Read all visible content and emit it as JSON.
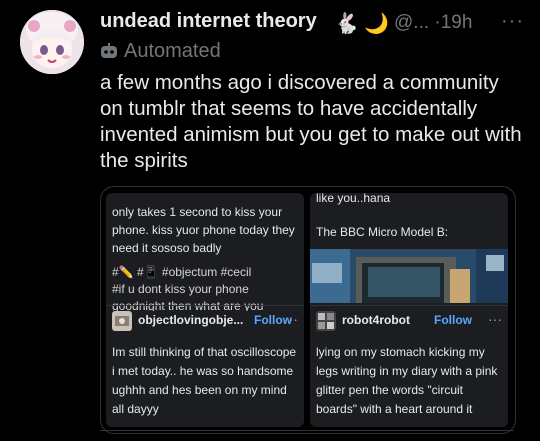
{
  "author": {
    "display_name": "undead internet theory",
    "emoji_1": "🐇",
    "emoji_2": "🌙",
    "handle": "@...",
    "separator": "·",
    "time": "19h",
    "more_icon": "more-horizontal-icon"
  },
  "automated": {
    "icon": "robot-icon",
    "label": "Automated"
  },
  "post": {
    "text": "a few months ago i discovered a community on tumblr that seems to have accidentally invented animism but you get to make out with the spirits"
  },
  "quote": {
    "left_card": {
      "top_text": "only takes 1 second to kiss your phone. kiss yuor phone today they need it sososo badly",
      "tags_line_1": "#✏️ #📱 #objectum #cecil",
      "tags_line_2": "#if u dont kiss your phone",
      "tags_line_3": "goodnight then what are you",
      "username": "objectlovingobje...",
      "follow_label": "Follow",
      "more_label": "···",
      "body": "Im still thinking of that oscilloscope i met today.. he was so handsome ughhh and hes been on my mind all dayyy"
    },
    "right_card": {
      "top_line_1": "like you..hana",
      "top_line_2": "The BBC Micro Model B:",
      "username": "robot4robot",
      "follow_label": "Follow",
      "more_label": "···",
      "body": "lying on my stomach kicking my legs writing in my diary with a pink glitter pen the words \"circuit boards\" with a heart around it"
    }
  },
  "colors": {
    "background": "#000000",
    "text": "#e7e9ea",
    "muted": "#71767b",
    "follow": "#5aa7ff",
    "card": "#1b1d20"
  }
}
